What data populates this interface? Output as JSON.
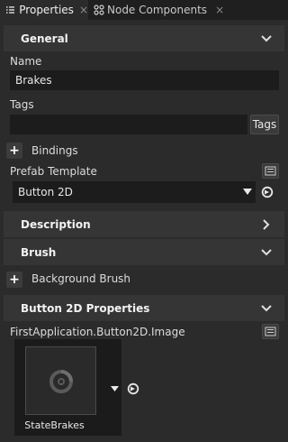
{
  "tabs": [
    {
      "label": "Properties",
      "icon": "list-icon",
      "close": "×"
    },
    {
      "label": "Node Components",
      "icon": "components-icon",
      "close": "×"
    }
  ],
  "sections": {
    "general": "General",
    "description": "Description",
    "brush": "Brush",
    "button2d": "Button 2D Properties"
  },
  "fields": {
    "name_label": "Name",
    "name_value": "Brakes",
    "tags_label": "Tags",
    "tags_button": "Tags",
    "bindings_label": "Bindings",
    "prefab_label": "Prefab Template",
    "prefab_value": "Button 2D",
    "background_brush_label": "Background Brush",
    "image_label": "FirstApplication.Button2D.Image",
    "image_caption": "StateBrakes"
  },
  "colors": {
    "background": "#2b2b2b",
    "section": "#353535",
    "field": "#1c1c1c",
    "text": "#e0e0e0"
  }
}
